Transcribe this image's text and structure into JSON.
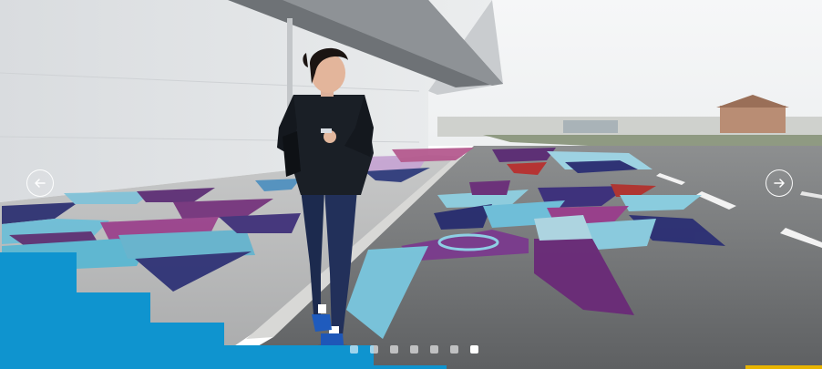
{
  "carousel": {
    "prev_icon": "arrow-left-icon",
    "next_icon": "arrow-right-icon",
    "active_slide": 7,
    "slide_count": 7
  },
  "colors": {
    "brand_blue": "#0f94cf",
    "dot_inactive": "rgba(255,255,255,0.6)",
    "dot_active": "#ffffff",
    "accent_gold": "#e8b400"
  }
}
